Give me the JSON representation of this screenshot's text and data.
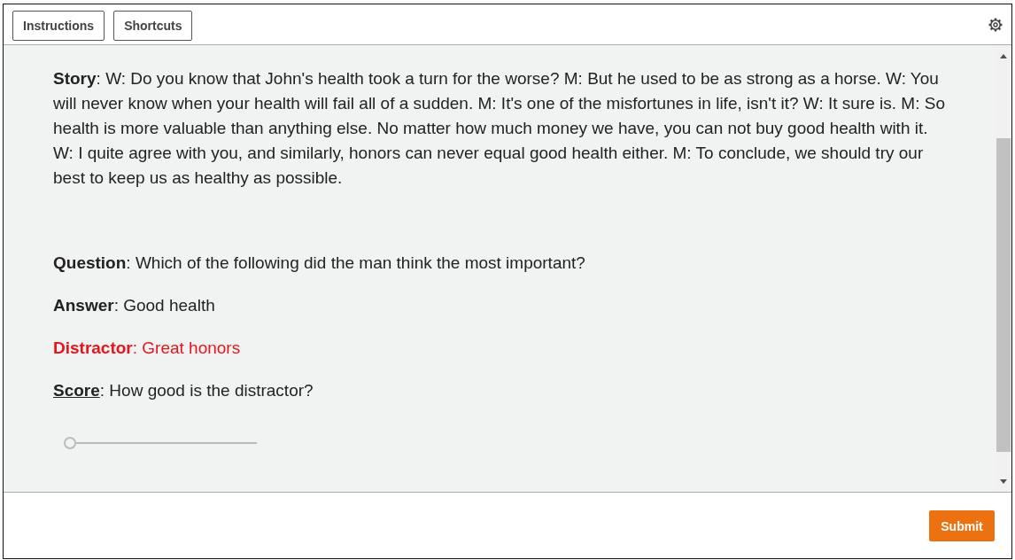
{
  "toolbar": {
    "buttons": [
      "Instructions",
      "Shortcuts"
    ]
  },
  "fields": [
    {
      "kind": "story",
      "label": "Story",
      "text": ": W: Do you know that John's health took a turn for the worse? M: But he used to be as strong as a horse. W: You will never know when your health will fail all of a sudden. M: It's one of the misfortunes in life, isn't it? W: It sure is. M: So health is more valuable than anything else. No matter how much money we have, you can not buy good health with it. W: I quite agree with you, and similarly, honors can never equal good health either. M: To conclude, we should try our best to keep us as healthy as possible."
    },
    {
      "kind": "question",
      "label": "Question",
      "text": ": Which of the following did the man think the most important?"
    },
    {
      "kind": "answer",
      "label": "Answer",
      "text": ": Good health"
    },
    {
      "kind": "distractor",
      "label": "Distractor",
      "text": ": Great honors"
    },
    {
      "kind": "score",
      "label": "Score",
      "text": ": How good is the distractor?"
    }
  ],
  "slider": {
    "level": 0
  },
  "footer": {
    "button": "Submit"
  }
}
